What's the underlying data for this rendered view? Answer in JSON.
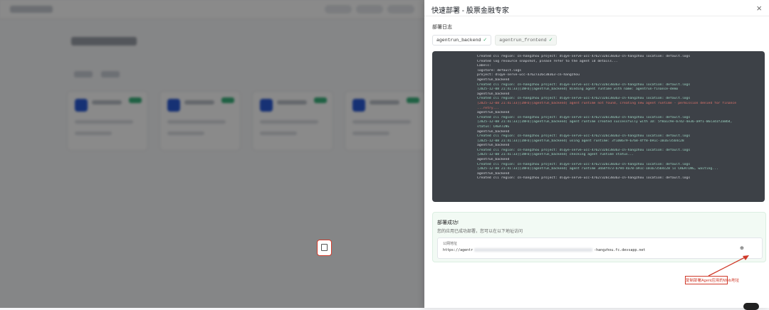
{
  "drawer": {
    "title": "快速部署 - 股票金融专家",
    "close_symbol": "×",
    "section_label": "部署日志",
    "tags": [
      {
        "label": "agentrun_backend",
        "check": "✓"
      },
      {
        "label": "agentrun_frontend",
        "check": "✓"
      }
    ],
    "log_lines": [
      {
        "text": "Created cli region: cn-hangzhou project: dlqye-serve-ucc-47627326c38363-cn-hangzhou location: default.logs",
        "color": "white"
      },
      {
        "text": "Created log resource snapshot, please refer to the agent id details...",
        "color": "white"
      },
      {
        "text": "Labels:",
        "color": "white"
      },
      {
        "text": "  logstore: default.logs",
        "color": "white"
      },
      {
        "text": "  project: dlqye-serve-ucc-47627326c38363-cn-hangzhou",
        "color": "white"
      },
      {
        "text": "agentrun_backend",
        "color": "white"
      },
      {
        "text": " Created cli region: cn-hangzhou project: dlqye-serve-ucc-47627326c38363-cn-hangzhou location: default.logs",
        "color": "green"
      },
      {
        "text": "[2025-12-08 21:41:33][INFO][agentrun_backend] Binding agent runtime with name: agentrun-finance-demo",
        "color": "green"
      },
      {
        "text": "agentrun_backend",
        "color": "white"
      },
      {
        "text": " Created cli region: cn-hangzhou project: dlqye-serve-ucc-47627326c38363-cn-hangzhou location: default.logs",
        "color": "green"
      },
      {
        "text": "[2025-12-08 21:41:33][INFO][agentrun_backend] agent runtime not found, creating new agent runtime - permission denied for finance",
        "color": "red"
      },
      {
        "text": " ...retry...",
        "color": "red"
      },
      {
        "text": "agentrun_backend",
        "color": "white"
      },
      {
        "text": " Created cli region: cn-hangzhou project: dlqye-serve-ucc-47627326c38363-cn-hangzhou location: default.logs",
        "color": "green"
      },
      {
        "text": "[2025-12-08 21:41:33][INFO][agentrun_backend] agent runtime created successfully with ID: 5f8a1c9e-b7d2-4e36-a9f1-06c3d1f2a8b4,",
        "color": "green"
      },
      {
        "text": "status: CREATING",
        "color": "green"
      },
      {
        "text": "agentrun_backend",
        "color": "white"
      },
      {
        "text": " Created cli region: cn-hangzhou project: dlqye-serve-ucc-47627326c38363-cn-hangzhou location: default.logs",
        "color": "green"
      },
      {
        "text": "[2025-12-08 21:41:33][INFO][agentrun_backend] using agent runtime: 3f1d0679-6768-4ff8-b91c-1016735b4c28",
        "color": "green"
      },
      {
        "text": "agentrun_backend",
        "color": "white"
      },
      {
        "text": " Created cli region: cn-hangzhou project: dlqye-serve-ucc-47627326c38363-cn-hangzhou location: default.logs",
        "color": "green"
      },
      {
        "text": "[2025-12-08 21:41:33][INFO][agentrun_backend] checking agent runtime status...",
        "color": "green"
      },
      {
        "text": "agentrun_backend",
        "color": "white"
      },
      {
        "text": " Created cli region: cn-hangzhou project: dlqye-serve-ucc-47627326c38363-cn-hangzhou location: default.logs",
        "color": "green"
      },
      {
        "text": "[2025-12-08 21:41:33][INFO][agentrun_backend] agent runtime 3da4f473-b794-4a78-a91c-1016735b4c28 is CREATING, waiting...",
        "color": "green"
      },
      {
        "text": "agentrun_backend",
        "color": "white"
      },
      {
        "text": " Created cli region: cn-hangzhou project: dlqye-serve-ucc-47627326c38363-cn-hangzhou location: default.logs",
        "color": "white"
      }
    ],
    "success": {
      "title": "部署成功!",
      "description": "您的应用已成功部署，您可以在以下地址访问",
      "endpoint_label": "公网地址",
      "endpoint_prefix": "https://agentr",
      "endpoint_suffix": "-hangzhou.fc.devsapp.net",
      "extra_symbol": "⊕"
    },
    "annotation": "复制部署Agent应用的Web地址"
  }
}
